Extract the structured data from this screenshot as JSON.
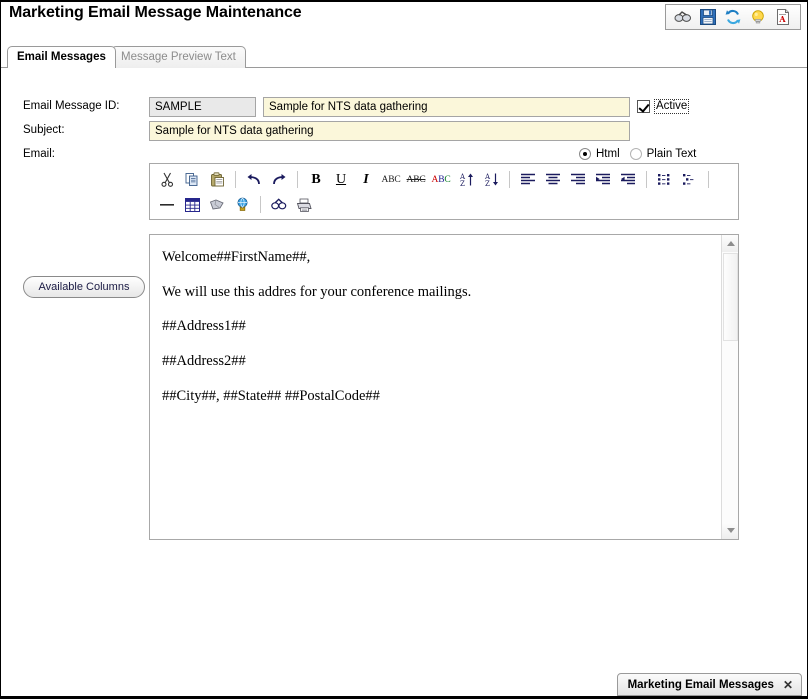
{
  "header": {
    "title": "Marketing Email Message Maintenance"
  },
  "top_toolbar": {
    "buttons": [
      {
        "name": "search-icon",
        "label": "Search"
      },
      {
        "name": "save-icon",
        "label": "Save"
      },
      {
        "name": "refresh-icon",
        "label": "Refresh"
      },
      {
        "name": "lightbulb-icon",
        "label": "Hints"
      },
      {
        "name": "report-icon",
        "label": "Report"
      }
    ]
  },
  "tabs": [
    {
      "label": "Email Messages",
      "active": true
    },
    {
      "label": "Message Preview Text",
      "active": false
    }
  ],
  "form": {
    "labels": {
      "message_id": "Email Message ID:",
      "subject": "Subject:",
      "email": "Email:"
    },
    "message_id_value": "SAMPLE",
    "message_name_value": "Sample for NTS data gathering",
    "subject_value": "Sample for NTS data gathering",
    "active_checkbox": {
      "label": "Active",
      "checked": true
    },
    "format_radios": [
      {
        "label": "Html",
        "selected": true
      },
      {
        "label": "Plain Text",
        "selected": false
      }
    ]
  },
  "buttons": {
    "available_columns": "Available Columns"
  },
  "editor": {
    "toolbar_row1": [
      {
        "name": "cut-icon",
        "label": "Cut"
      },
      {
        "name": "copy-icon",
        "label": "Copy"
      },
      {
        "name": "paste-icon",
        "label": "Paste"
      },
      {
        "name": "undo-icon",
        "label": "Undo"
      },
      {
        "name": "redo-icon",
        "label": "Redo"
      },
      {
        "name": "bold-icon",
        "label": "B"
      },
      {
        "name": "underline-icon",
        "label": "U"
      },
      {
        "name": "italic-icon",
        "label": "I"
      },
      {
        "name": "spellcheck-icon",
        "label": "ABC"
      },
      {
        "name": "strikethrough-icon",
        "label": "ABC"
      },
      {
        "name": "font-color-icon",
        "label": "ABC"
      },
      {
        "name": "sort-ascending-icon",
        "label": "Sort Ascending"
      },
      {
        "name": "sort-descending-icon",
        "label": "Sort Descending"
      },
      {
        "name": "align-left-icon",
        "label": "Align Left"
      },
      {
        "name": "align-center-icon",
        "label": "Align Center"
      },
      {
        "name": "align-right-icon",
        "label": "Align Right"
      },
      {
        "name": "indent-icon",
        "label": "Increase Indent"
      },
      {
        "name": "outdent-icon",
        "label": "Decrease Indent"
      },
      {
        "name": "bulleted-list-icon",
        "label": "Bulleted List"
      },
      {
        "name": "numbered-list-icon",
        "label": "Numbered List"
      }
    ],
    "toolbar_row2": [
      {
        "name": "horizontal-rule-icon",
        "label": "Horizontal Rule"
      },
      {
        "name": "insert-table-icon",
        "label": "Insert Table"
      },
      {
        "name": "insert-shape-icon",
        "label": "Insert Shape"
      },
      {
        "name": "insert-hyperlink-icon",
        "label": "Insert Hyperlink"
      },
      {
        "name": "find-icon",
        "label": "Find"
      },
      {
        "name": "print-icon",
        "label": "Print"
      }
    ],
    "body_paragraphs": [
      "Welcome##FirstName##,",
      "We will use this addres for your conference mailings.",
      "##Address1##",
      "##Address2##",
      "##City##, ##State##  ##PostalCode##"
    ]
  },
  "taskbar": {
    "item_label": "Marketing Email Messages",
    "close_label": "✕"
  },
  "colors": {
    "editable_field": "#fbf7da",
    "readonly_field": "#e9e9e9",
    "border": "#a5a5a5",
    "accent": "#1b1b5e"
  }
}
